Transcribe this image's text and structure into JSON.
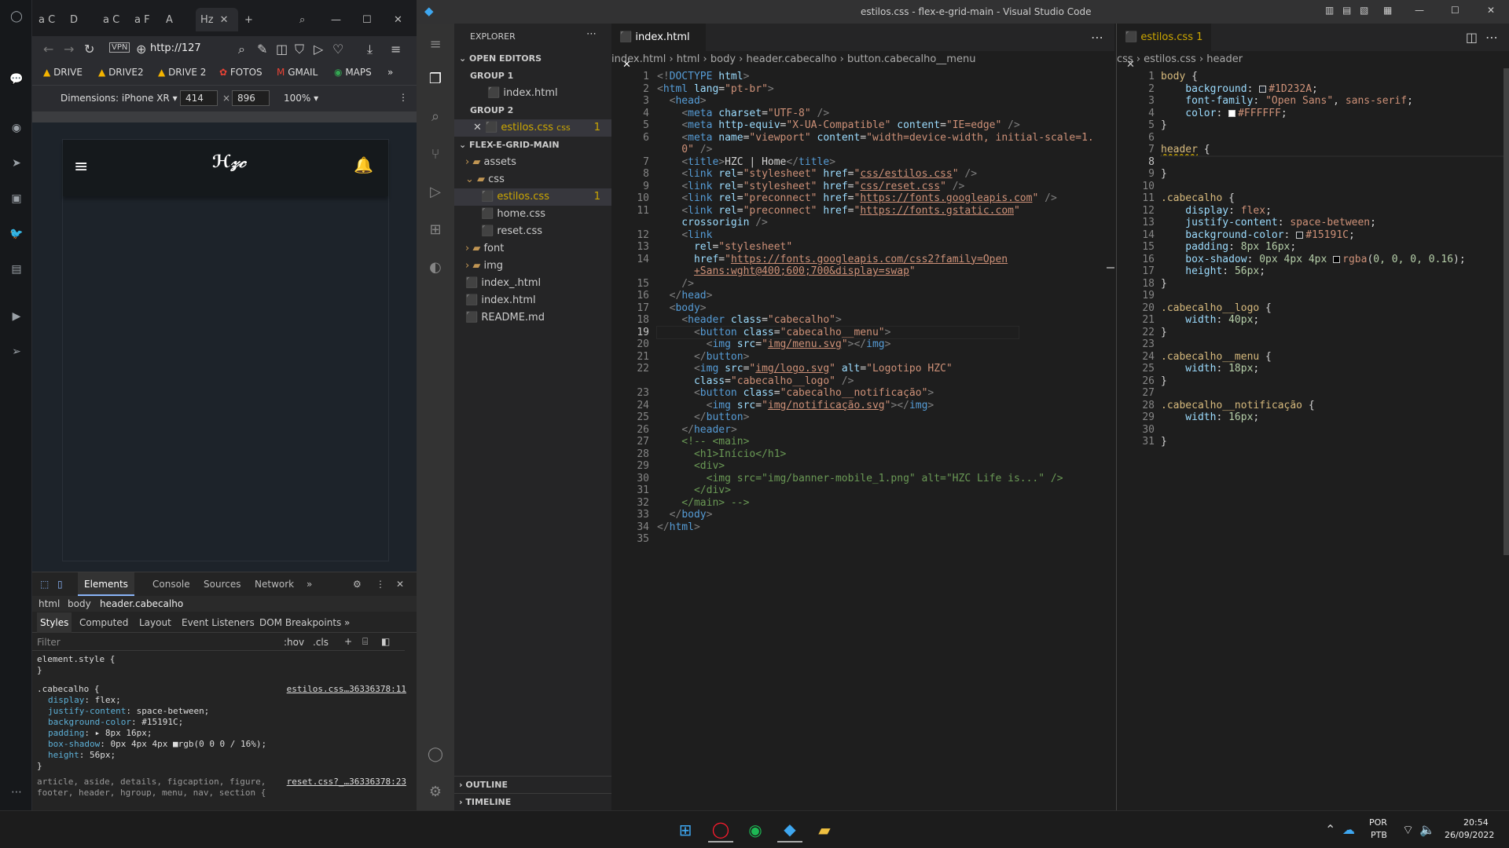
{
  "browser": {
    "tabs": [
      "a C",
      "D",
      "a C",
      "a F",
      "A",
      "H"
    ],
    "active_tab_label": "Hz",
    "url": "http://127",
    "vpn_label": "VPN",
    "bookmarks": [
      "DRIVE",
      "DRIVE2",
      "DRIVE 2",
      "FOTOS",
      "GMAIL",
      "MAPS"
    ],
    "device_mode": {
      "device": "Dimensions: iPhone XR",
      "width": "414",
      "height": "896",
      "zoom": "100%"
    }
  },
  "devtools": {
    "tabs": [
      "Elements",
      "Console",
      "Sources",
      "Network"
    ],
    "breadcrumb": [
      "html",
      "body",
      "header.cabecalho"
    ],
    "subtabs": [
      "Styles",
      "Computed",
      "Layout",
      "Event Listeners",
      "DOM Breakpoints"
    ],
    "filter_placeholder": "Filter",
    "hov": ":hov",
    "cls": ".cls",
    "element_style": "element.style {",
    "close_brace": "}",
    "rule_selector": ".cabecalho {",
    "rule_source": "estilos.css…36336378:11",
    "props": [
      {
        "name": "display",
        "value": "flex;"
      },
      {
        "name": "justify-content",
        "value": "space-between;"
      },
      {
        "name": "background-color",
        "value": "#15191C;"
      },
      {
        "name": "padding",
        "value": "▸ 8px 16px;"
      },
      {
        "name": "box-shadow",
        "value": "0px 4px 4px ■rgb(0 0 0 / 16%);"
      },
      {
        "name": "height",
        "value": "56px;"
      }
    ],
    "reset_source": "reset.css?_…36336378:23",
    "reset_line1": "article, aside, details, figcaption, figure,",
    "reset_line2": "footer, header, hgroup, menu, nav, section {"
  },
  "vscode": {
    "title": "estilos.css - flex-e-grid-main - Visual Studio Code",
    "explorer": {
      "header": "EXPLORER",
      "open_editors": "OPEN EDITORS",
      "group1": "GROUP 1",
      "group1_file": "index.html",
      "group2": "GROUP 2",
      "group2_file": "estilos.css",
      "group2_path": "css",
      "group2_badge": "1",
      "project": "FLEX-E-GRID-MAIN",
      "tree": [
        {
          "label": "assets",
          "indent": 1,
          "kind": "folder"
        },
        {
          "label": "css",
          "indent": 1,
          "kind": "folder-open"
        },
        {
          "label": "estilos.css",
          "indent": 2,
          "kind": "css",
          "badge": "1"
        },
        {
          "label": "home.css",
          "indent": 2,
          "kind": "css"
        },
        {
          "label": "reset.css",
          "indent": 2,
          "kind": "css"
        },
        {
          "label": "font",
          "indent": 1,
          "kind": "folder"
        },
        {
          "label": "img",
          "indent": 1,
          "kind": "folder"
        },
        {
          "label": "index_.html",
          "indent": 1,
          "kind": "html"
        },
        {
          "label": "index.html",
          "indent": 1,
          "kind": "html"
        },
        {
          "label": "README.md",
          "indent": 1,
          "kind": "md"
        }
      ],
      "outline": "OUTLINE",
      "timeline": "TIMELINE"
    },
    "editor1": {
      "tab": "index.html",
      "breadcrumb": [
        "index.html",
        "html",
        "body",
        "header.cabecalho",
        "button.cabecalho__menu"
      ],
      "current_line": "19"
    },
    "editor2": {
      "tab": "estilos.css",
      "tab_badge": "1",
      "breadcrumb": [
        "css",
        "estilos.css",
        "header"
      ],
      "current_line": "8"
    }
  },
  "taskbar": {
    "lang1": "POR",
    "lang2": "PTB",
    "time": "20:54",
    "date": "26/09/2022"
  }
}
